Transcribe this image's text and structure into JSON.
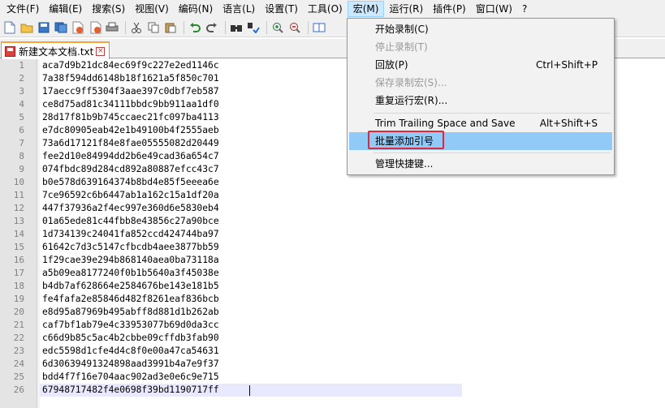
{
  "menubar": {
    "items": [
      "文件(F)",
      "编辑(E)",
      "搜索(S)",
      "视图(V)",
      "编码(N)",
      "语言(L)",
      "设置(T)",
      "工具(O)",
      "宏(M)",
      "运行(R)",
      "插件(P)",
      "窗口(W)",
      "?"
    ],
    "active_index": 8
  },
  "toolbar": {
    "icons": [
      "new-file-icon",
      "open-file-icon",
      "save-icon",
      "save-all-icon",
      "close-icon",
      "close-all-icon",
      "print-icon",
      "cut-icon",
      "copy-icon",
      "paste-icon",
      "undo-icon",
      "redo-icon",
      "find-icon",
      "replace-icon",
      "zoom-in-icon",
      "zoom-out-icon",
      "sync-icon"
    ]
  },
  "tab": {
    "label": "新建文本文档.txt",
    "close": "×"
  },
  "editor": {
    "lines": [
      "aca7d9b21dc84ec69f9c227e2ed1146c",
      "7a38f594dd6148b18f1621a5f850c701",
      "17aecc9ff5304f3aae397c0dbf7eb587",
      "ce8d75ad81c34111bbdc9bb911aa1df0",
      "28d17f81b9b745ccaec21fc097ba4113",
      "e7dc80905eab42e1b49100b4f2555aeb",
      "73a6d17121f84e8fae05555082d20449",
      "fee2d10e84994dd2b6e49cad36a654c7",
      "074fbdc89d284cd892a80887efcc43c7",
      "b0e578d639164374b8bd4e85f5eeea6e",
      "7ce96592c6b6447ab1a162c15a1df20a",
      "447f37936a2f4ec997e360d6e5830eb4",
      "01a65ede81c44fbb8e43856c27a90bce",
      "1d734139c24041fa852ccd424744ba97",
      "61642c7d3c5147cfbcdb4aee3877bb59",
      "1f29cae39e294b868140aea0ba73118a",
      "a5b09ea8177240f0b1b5640a3f45038e",
      "b4db7af628664e2584676be143e181b5",
      "fe4fafa2e85846d482f8261eaf836bcb",
      "e8d95a87969b495abff8d881d1b262ab",
      "caf7bf1ab79e4c33953077b69d0da3cc",
      "c66d9b85c5ac4b2cbbe09cffdb3fab90",
      "edc5598d1cfe4d4c8f0e00a47ca54631",
      "6d30639491324898aad3991b4a7e9f37",
      "bdd4f7f16e704aac902ad3e0e6c9e715",
      "67948717482f4e0698f39bd1190717ff"
    ]
  },
  "macro_menu": {
    "items": [
      {
        "label": "开始录制(C)",
        "shortcut": "",
        "disabled": false
      },
      {
        "label": "停止录制(T)",
        "shortcut": "",
        "disabled": true
      },
      {
        "label": "回放(P)",
        "shortcut": "Ctrl+Shift+P",
        "disabled": false
      },
      {
        "label": "保存录制宏(S)...",
        "shortcut": "",
        "disabled": true
      },
      {
        "label": "重复运行宏(R)...",
        "shortcut": "",
        "disabled": false
      },
      {
        "label": "Trim Trailing Space and Save",
        "shortcut": "Alt+Shift+S",
        "disabled": false
      },
      {
        "label": "批量添加引号",
        "shortcut": "",
        "disabled": false
      },
      {
        "label": "管理快捷键...",
        "shortcut": "",
        "disabled": false
      }
    ],
    "highlighted_index": 6
  },
  "colors": {
    "highlight": "#91c9f7",
    "annotation_box": "#e0283c",
    "tab_accent": "#f9a53a"
  }
}
